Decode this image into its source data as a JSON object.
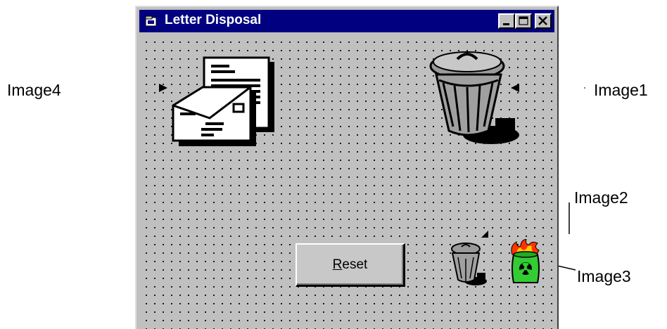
{
  "window": {
    "title": "Letter Disposal"
  },
  "button": {
    "reset_first": "R",
    "reset_rest": "eset"
  },
  "labels": {
    "image4": "Image4",
    "image1": "Image1",
    "image2": "Image2",
    "image3": "Image3"
  },
  "icons": {
    "letter": "letter-envelope-icon",
    "trash_large": "trash-can-icon",
    "trash_small": "small-trash-can-icon",
    "burning_barrel": "burning-barrel-icon"
  },
  "colors": {
    "titlebar": "#000080",
    "face": "#c0c0c0",
    "barrel": "#33cc33",
    "flame": "#ff6600"
  }
}
